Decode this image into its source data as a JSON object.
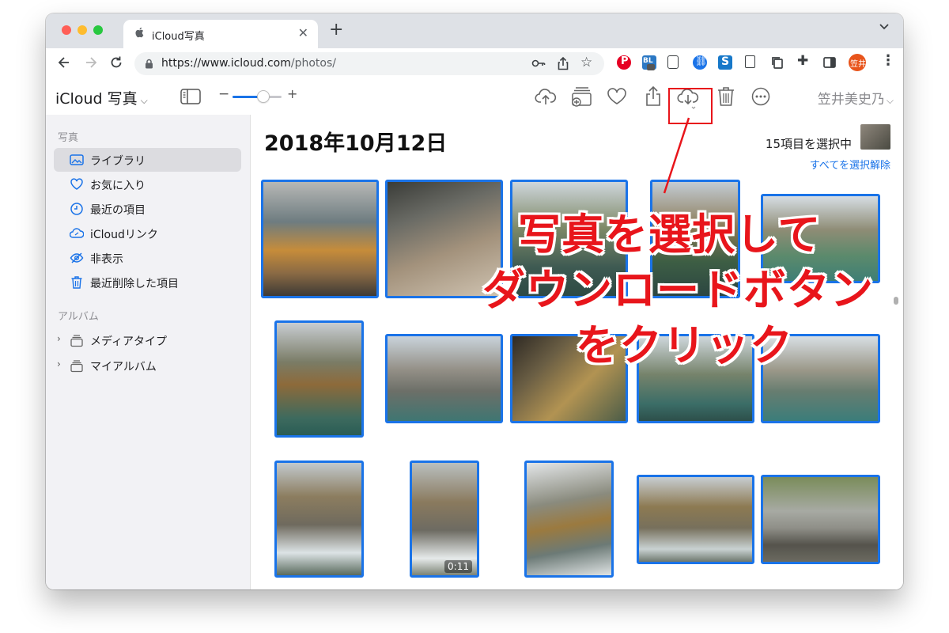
{
  "browser": {
    "tab_title": "iCloud写真",
    "url_host": "https://www.icloud.com",
    "url_path": "/photos/",
    "profile_initials": "笠井"
  },
  "app": {
    "name": "iCloud 写真",
    "user_name": "笠井美史乃"
  },
  "sidebar": {
    "section_photos": "写真",
    "items": [
      {
        "label": "ライブラリ",
        "icon": "library-icon",
        "active": true
      },
      {
        "label": "お気に入り",
        "icon": "heart-icon"
      },
      {
        "label": "最近の項目",
        "icon": "clock-icon"
      },
      {
        "label": "iCloudリンク",
        "icon": "cloud-link-icon"
      },
      {
        "label": "非表示",
        "icon": "eye-slash-icon"
      },
      {
        "label": "最近削除した項目",
        "icon": "trash-icon"
      }
    ],
    "section_albums": "アルバム",
    "albums": [
      {
        "label": "メディアタイプ",
        "icon": "album-stack-icon"
      },
      {
        "label": "マイアルバム",
        "icon": "album-stack-icon"
      }
    ]
  },
  "main": {
    "date": "2018年10月12日",
    "selection_count": "15項目を選択中",
    "deselect_all": "すべてを選択解除",
    "video_duration": "0:11"
  },
  "annotation": {
    "line1": "写真を選択して",
    "line2": "ダウンロードボタン",
    "line3": "をクリック"
  },
  "colors": {
    "selection_blue": "#1a73e8",
    "annotation_red": "#e8151b"
  }
}
